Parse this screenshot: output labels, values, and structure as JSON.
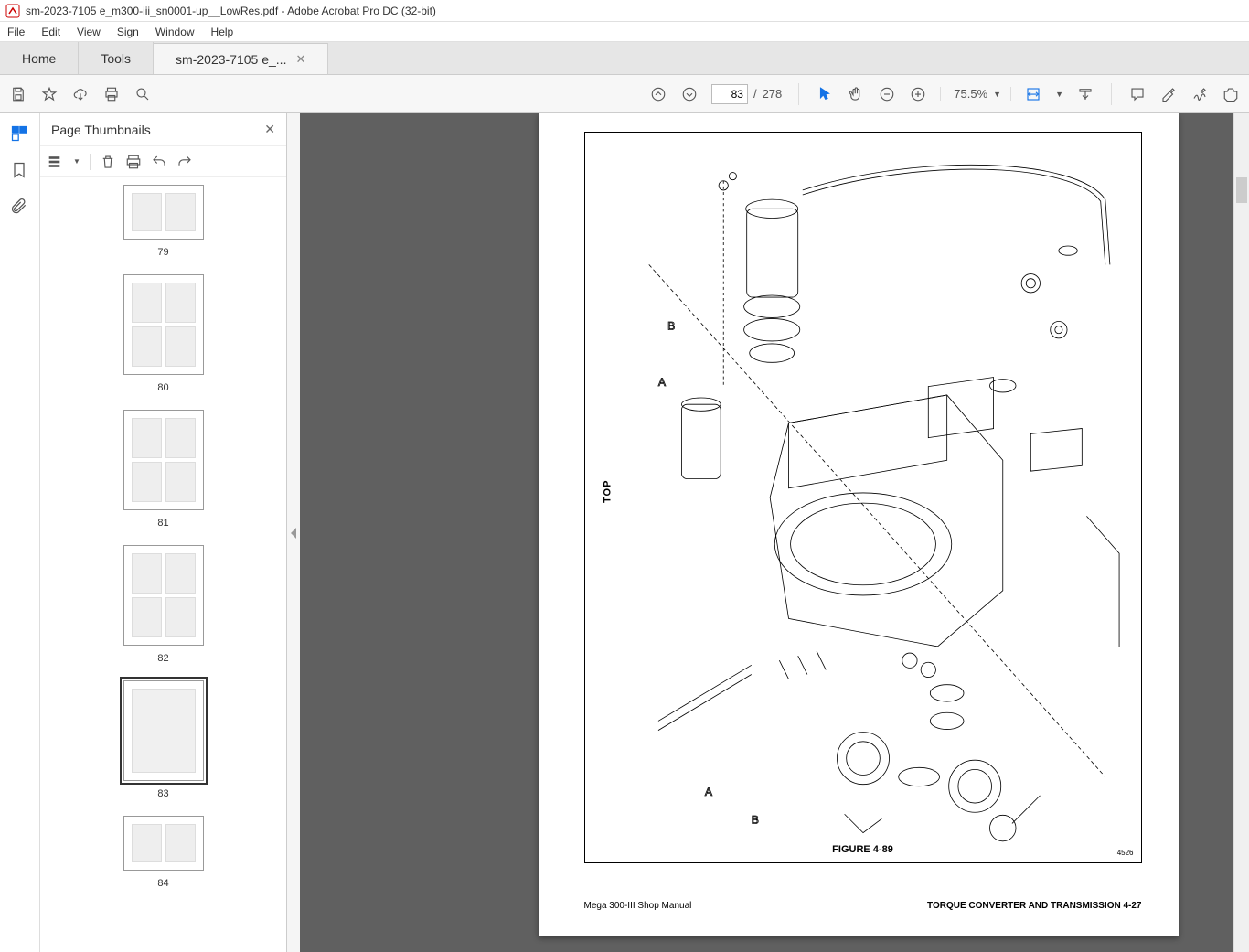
{
  "window": {
    "title": "sm-2023-7105 e_m300-iii_sn0001-up__LowRes.pdf - Adobe Acrobat Pro DC (32-bit)"
  },
  "menu": {
    "items": [
      "File",
      "Edit",
      "View",
      "Sign",
      "Window",
      "Help"
    ]
  },
  "tabs": {
    "home": "Home",
    "tools": "Tools",
    "doc": "sm-2023-7105 e_..."
  },
  "toolbar": {
    "page_current": "83",
    "page_sep": "/",
    "page_total": "278",
    "zoom": "75.5%"
  },
  "thumbs": {
    "title": "Page Thumbnails",
    "pages": [
      {
        "num": "79",
        "selected": false,
        "layout": "half"
      },
      {
        "num": "80",
        "selected": false,
        "layout": "grid"
      },
      {
        "num": "81",
        "selected": false,
        "layout": "grid"
      },
      {
        "num": "82",
        "selected": false,
        "layout": "grid"
      },
      {
        "num": "83",
        "selected": true,
        "layout": "single"
      },
      {
        "num": "84",
        "selected": false,
        "layout": "half"
      }
    ]
  },
  "doc": {
    "side_label": "TOP",
    "fig_caption": "FIGURE 4-89",
    "fig_num": "4526",
    "footer_left": "Mega 300-III Shop Manual",
    "footer_right": "TORQUE CONVERTER AND TRANSMISSION   4-27"
  }
}
